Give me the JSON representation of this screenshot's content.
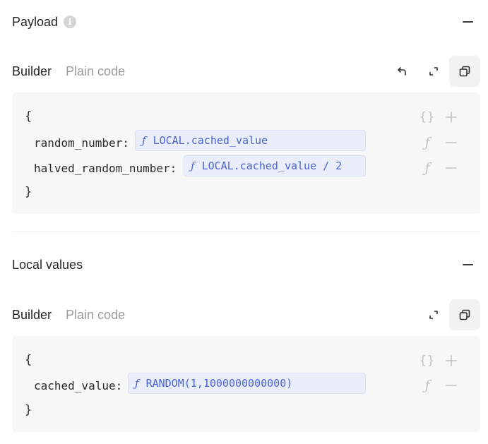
{
  "payload": {
    "title": "Payload",
    "info_glyph": "i",
    "tabs": [
      {
        "label": "Builder",
        "active": true
      },
      {
        "label": "Plain code",
        "active": false
      }
    ],
    "open_brace": "{",
    "close_brace": "}",
    "rows": [
      {
        "key": "random_number",
        "colon": ":",
        "fn_glyph": "ƒ",
        "expression": "LOCAL.cached_value"
      },
      {
        "key": "halved_random_number",
        "colon": ":",
        "fn_glyph": "ƒ",
        "expression": "LOCAL.cached_value / 2"
      }
    ]
  },
  "local_values": {
    "title": "Local values",
    "tabs": [
      {
        "label": "Builder",
        "active": true
      },
      {
        "label": "Plain code",
        "active": false
      }
    ],
    "open_brace": "{",
    "close_brace": "}",
    "rows": [
      {
        "key": "cached_value",
        "colon": ":",
        "fn_glyph": "ƒ",
        "expression": "RANDOM(1,1000000000000)"
      }
    ]
  },
  "actions": {
    "object_glyph": "{}",
    "fn_glyph": "ƒ"
  },
  "icons": {
    "info": "info-icon",
    "collapse": "minus-icon",
    "undo": "undo-arrow-icon",
    "expand": "expand-icon",
    "copy": "copy-icon",
    "add": "plus-icon",
    "remove": "minus-icon"
  },
  "colors": {
    "expression_bg": "#eaeefb",
    "expression_text": "#4b63d1",
    "code_bg": "#f7f7f7",
    "muted_icon": "#c2c2c2"
  }
}
